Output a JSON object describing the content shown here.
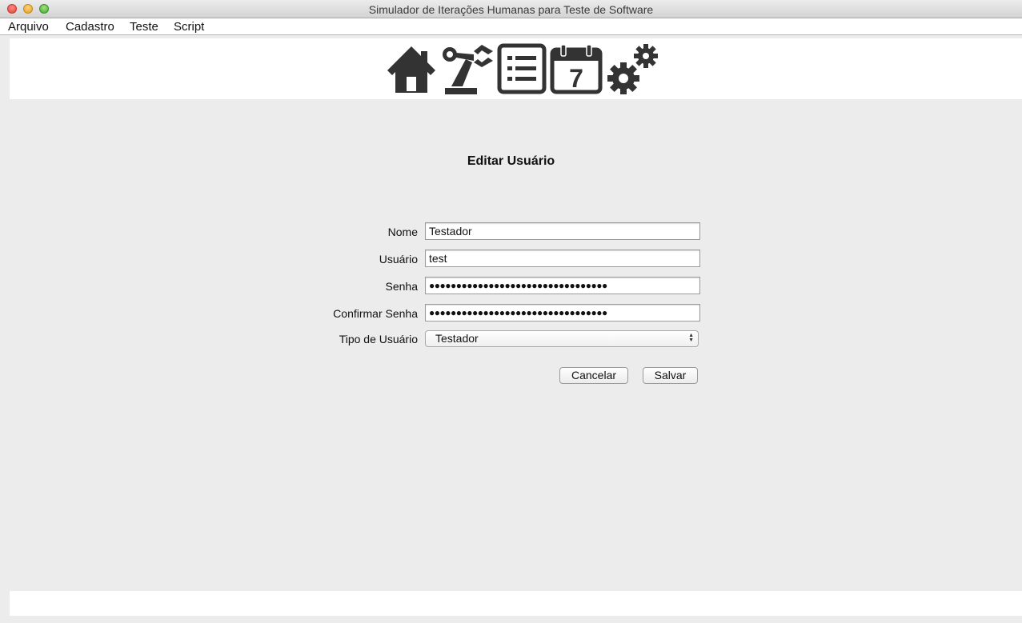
{
  "window": {
    "title": "Simulador de Iterações Humanas para Teste de Software"
  },
  "menu": {
    "items": [
      "Arquivo",
      "Cadastro",
      "Teste",
      "Script"
    ]
  },
  "toolbar": {
    "icons": [
      "home-icon",
      "robot-arm-icon",
      "list-icon",
      "calendar-icon",
      "gears-icon"
    ],
    "calendar_day": "7"
  },
  "form": {
    "title": "Editar Usuário",
    "fields": {
      "nome": {
        "label": "Nome",
        "value": "Testador"
      },
      "usuario": {
        "label": "Usuário",
        "value": "test"
      },
      "senha": {
        "label": "Senha",
        "value": "●●●●●●●●●●●●●●●●●●●●●●●●●●●●●●●●●"
      },
      "confirmar_senha": {
        "label": "Confirmar Senha",
        "value": "●●●●●●●●●●●●●●●●●●●●●●●●●●●●●●●●●"
      },
      "tipo_usuario": {
        "label": "Tipo de Usuário",
        "value": "Testador"
      }
    },
    "buttons": {
      "cancel": "Cancelar",
      "save": "Salvar"
    }
  }
}
